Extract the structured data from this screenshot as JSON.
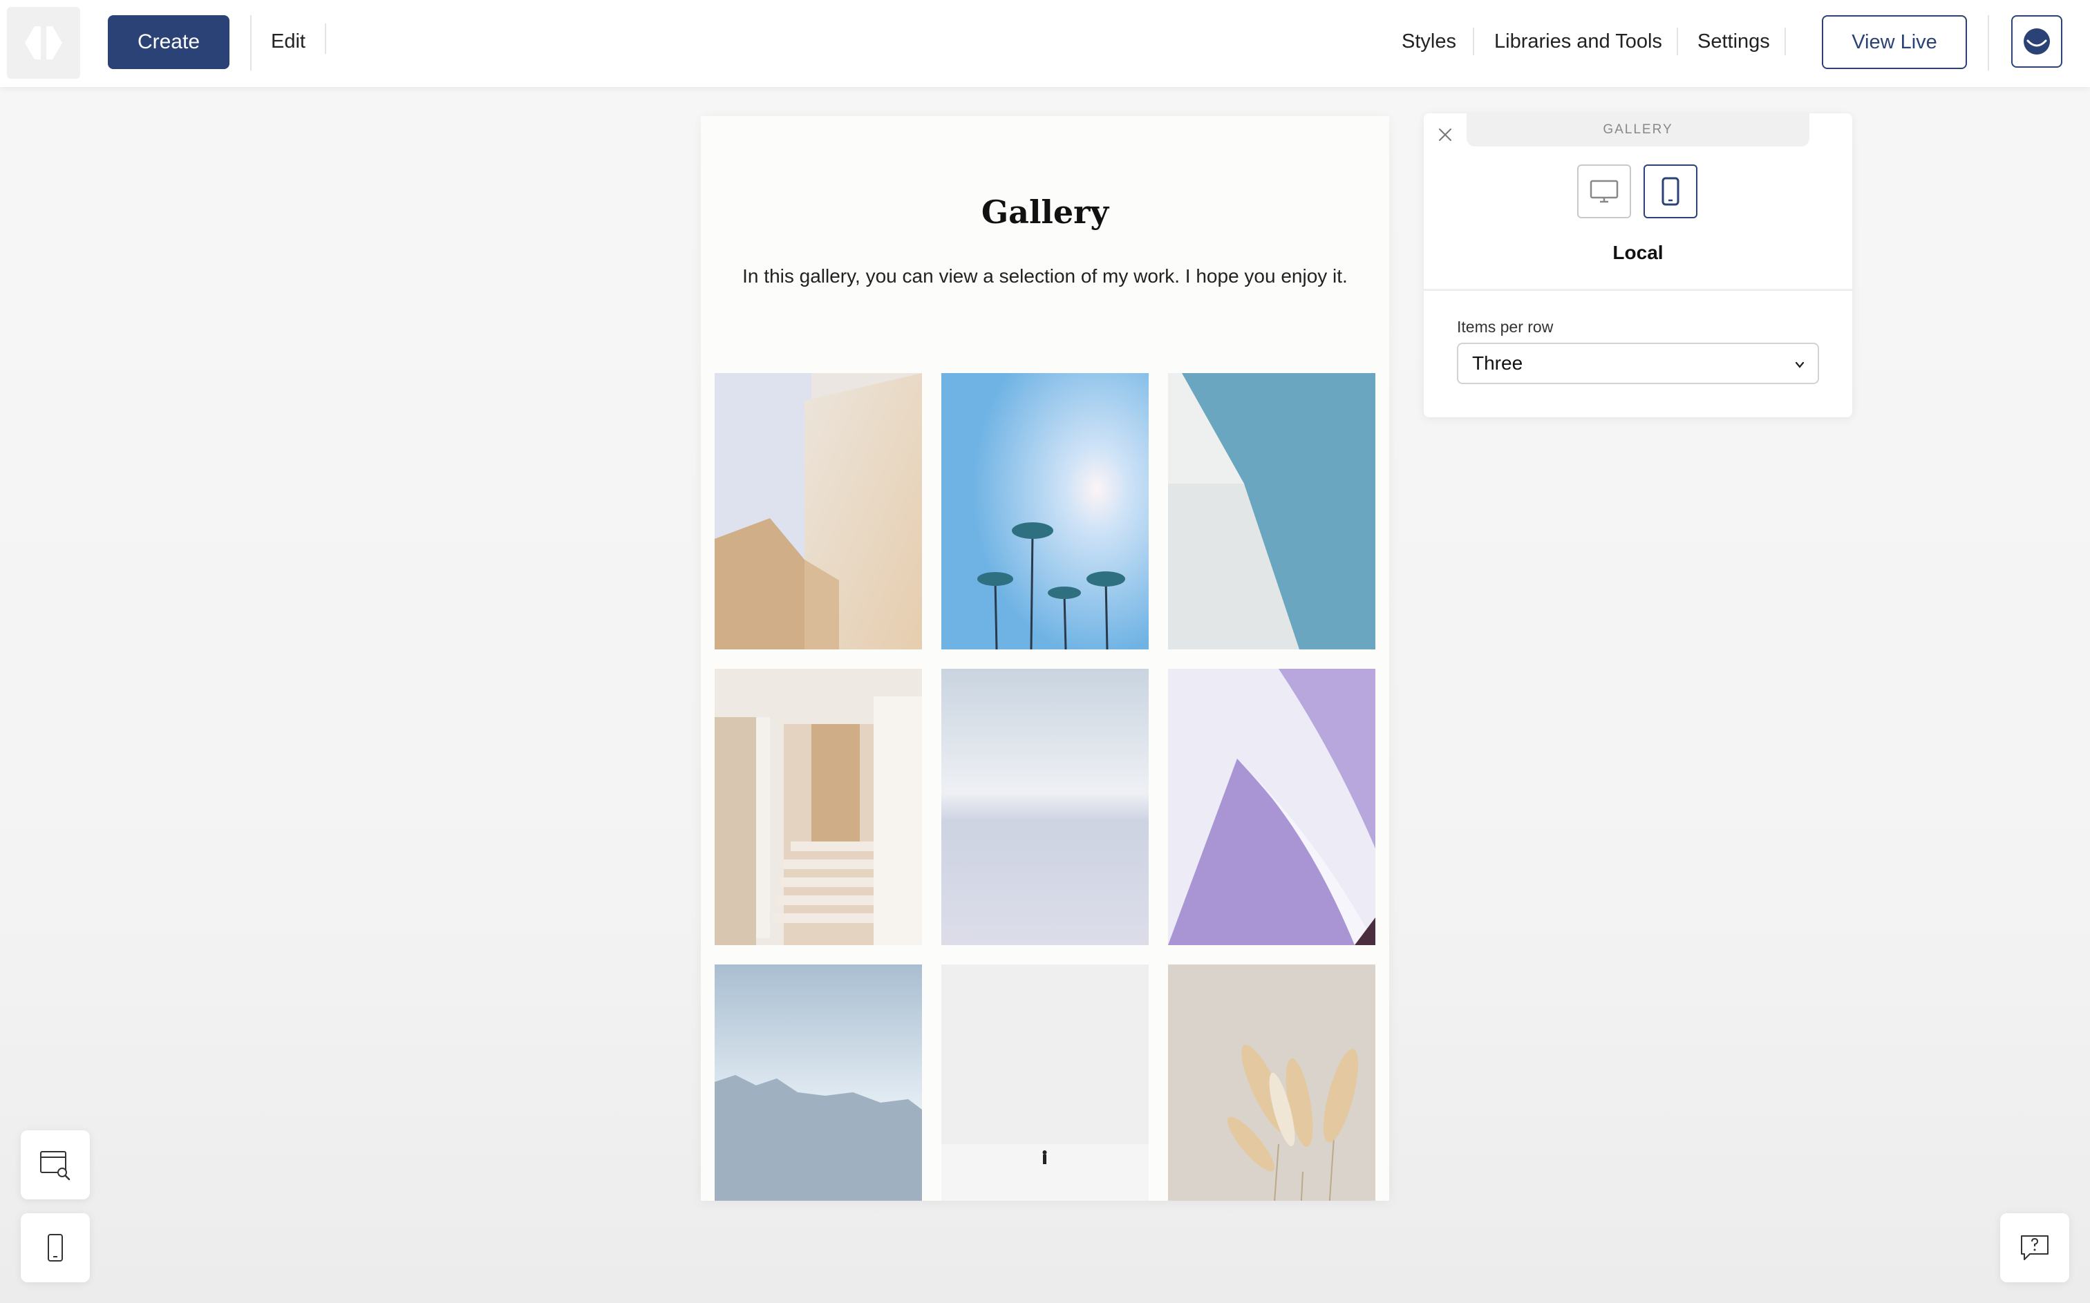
{
  "toolbar": {
    "create_label": "Create",
    "edit_label": "Edit",
    "nav": [
      "Styles",
      "Libraries and Tools",
      "Settings"
    ],
    "view_live_label": "View Live"
  },
  "page": {
    "title": "Gallery",
    "description": "In this gallery, you can view a selection of my work. I hope you enjoy it.",
    "images": [
      {
        "subject": "beige architecture wall"
      },
      {
        "subject": "palm trees against blue sky"
      },
      {
        "subject": "white building edge against blue sky"
      },
      {
        "subject": "sunlit staircase"
      },
      {
        "subject": "pale misty beach"
      },
      {
        "subject": "lilac curved facade"
      },
      {
        "subject": "misty blue forest"
      },
      {
        "subject": "lone figure in snowy field"
      },
      {
        "subject": "pampas grass"
      }
    ]
  },
  "panel": {
    "tab_label": "GALLERY",
    "scope_label": "Local",
    "items_per_row_label": "Items per row",
    "items_per_row_value": "Three",
    "active_device": "mobile"
  },
  "colors": {
    "accent": "#2b4276",
    "background": "#f5f5f5"
  }
}
